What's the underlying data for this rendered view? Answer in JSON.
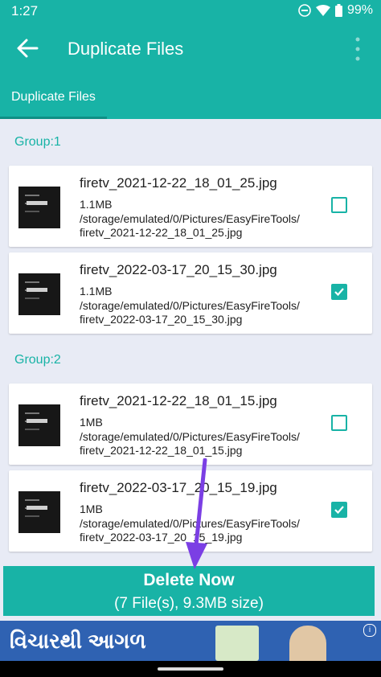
{
  "status_bar": {
    "time": "1:27",
    "battery": "99%"
  },
  "appbar": {
    "title": "Duplicate Files",
    "back_icon": "arrow-left-icon",
    "more_icon": "more-vert-icon"
  },
  "tabs": [
    {
      "label": "Duplicate Files"
    }
  ],
  "groups": [
    {
      "label": "Group:1",
      "files": [
        {
          "name": "firetv_2021-12-22_18_01_25.jpg",
          "size": "1.1MB",
          "path": "/storage/emulated/0/Pictures/EasyFireTools/\nfiretv_2021-12-22_18_01_25.jpg",
          "checked": false
        },
        {
          "name": "firetv_2022-03-17_20_15_30.jpg",
          "size": "1.1MB",
          "path": "/storage/emulated/0/Pictures/EasyFireTools/\nfiretv_2022-03-17_20_15_30.jpg",
          "checked": true
        }
      ]
    },
    {
      "label": "Group:2",
      "files": [
        {
          "name": "firetv_2021-12-22_18_01_15.jpg",
          "size": "1MB",
          "path": "/storage/emulated/0/Pictures/EasyFireTools/\nfiretv_2021-12-22_18_01_15.jpg",
          "checked": false
        },
        {
          "name": "firetv_2022-03-17_20_15_19.jpg",
          "size": "1MB",
          "path": "/storage/emulated/0/Pictures/EasyFireTools/\nfiretv_2022-03-17_20_15_19.jpg",
          "checked": true
        }
      ]
    }
  ],
  "delete_button": {
    "label": "Delete Now",
    "summary": "(7 File(s), 9.3MB size)"
  },
  "ad": {
    "text": "વિચારથી આગળ"
  },
  "colors": {
    "accent": "#18b3a6",
    "background": "#e8ebf5",
    "annotation_arrow": "#7b3fe4",
    "ad_background": "#2f62b2"
  }
}
